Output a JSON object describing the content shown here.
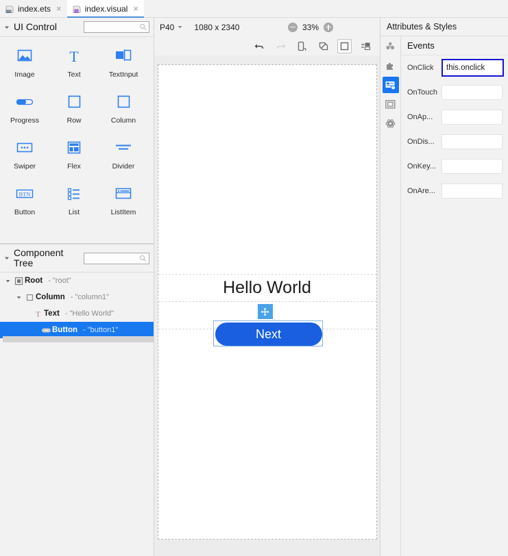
{
  "tabs": [
    {
      "label": "index.ets",
      "icon": "ets-file-icon",
      "active": false,
      "close": "×"
    },
    {
      "label": "index.visual",
      "icon": "visual-file-icon",
      "active": true,
      "close": "×"
    }
  ],
  "ui_control": {
    "title": "UI Control",
    "search_placeholder": "",
    "search_value": "",
    "items": [
      {
        "label": "Image",
        "icon": "image-icon"
      },
      {
        "label": "Text",
        "icon": "text-icon"
      },
      {
        "label": "TextInput",
        "icon": "textinput-icon"
      },
      {
        "label": "Progress",
        "icon": "progress-icon"
      },
      {
        "label": "Row",
        "icon": "row-icon"
      },
      {
        "label": "Column",
        "icon": "column-icon"
      },
      {
        "label": "Swiper",
        "icon": "swiper-icon"
      },
      {
        "label": "Flex",
        "icon": "flex-icon"
      },
      {
        "label": "Divider",
        "icon": "divider-icon"
      },
      {
        "label": "Button",
        "icon": "button-icon"
      },
      {
        "label": "List",
        "icon": "list-icon"
      },
      {
        "label": "ListItem",
        "icon": "listitem-icon"
      }
    ]
  },
  "component_tree": {
    "title": "Component\nTree",
    "search_value": "",
    "nodes": [
      {
        "name": "Root",
        "value": "- \"root\"",
        "icon": "root-icon",
        "depth": 0,
        "selected": false,
        "expanded": true
      },
      {
        "name": "Column",
        "value": "- \"column1\"",
        "icon": "column-node-icon",
        "depth": 1,
        "selected": false,
        "expanded": true
      },
      {
        "name": "Text",
        "value": "- \"Hello World\"",
        "icon": "text-node-icon",
        "depth": 2,
        "selected": false,
        "expanded": false
      },
      {
        "name": "Button",
        "value": "- \"button1\"",
        "icon": "button-node-icon",
        "depth": 2,
        "selected": true,
        "expanded": false
      }
    ]
  },
  "canvas": {
    "device": "P40",
    "resolution": "1080 x 2340",
    "zoom": "33%",
    "zoom_out_icon": "minus-circle-icon",
    "zoom_in_icon": "plus-circle-icon",
    "tools": [
      {
        "name": "undo-icon",
        "enabled": true
      },
      {
        "name": "redo-icon",
        "enabled": false
      },
      {
        "name": "rotate-device-icon",
        "enabled": true
      },
      {
        "name": "resize-icon",
        "enabled": true
      },
      {
        "name": "frame-icon",
        "enabled": true,
        "framed": true
      },
      {
        "name": "layout-icon",
        "enabled": true
      }
    ],
    "preview": {
      "text_label": "Hello World",
      "button_label": "Next",
      "move_handle_icon": "move-handle-icon",
      "button_color": "#1a5fe0",
      "selection_color": "#7fb3e8"
    }
  },
  "attributes": {
    "title": "Attributes & Styles",
    "side_icons": [
      {
        "name": "structure-icon",
        "active": false
      },
      {
        "name": "puzzle-icon",
        "active": false
      },
      {
        "name": "events-icon",
        "active": true
      },
      {
        "name": "layout-box-icon",
        "active": false
      },
      {
        "name": "atom-icon",
        "active": false
      }
    ],
    "events_title": "Events",
    "events": [
      {
        "label": "OnClick",
        "value": "this.onclick",
        "focused": true
      },
      {
        "label": "OnTouch",
        "value": "",
        "focused": false
      },
      {
        "label": "OnAp...",
        "value": "",
        "focused": false
      },
      {
        "label": "OnDis...",
        "value": "",
        "focused": false
      },
      {
        "label": "OnKey...",
        "value": "",
        "focused": false
      },
      {
        "label": "OnAre...",
        "value": "",
        "focused": false
      }
    ]
  },
  "colors": {
    "accent": "#1878f0",
    "focus_border": "#1414d2",
    "button_blue": "#1a5fe0",
    "panel_bg": "#f2f2f2",
    "canvas_bg": "#ececec"
  }
}
